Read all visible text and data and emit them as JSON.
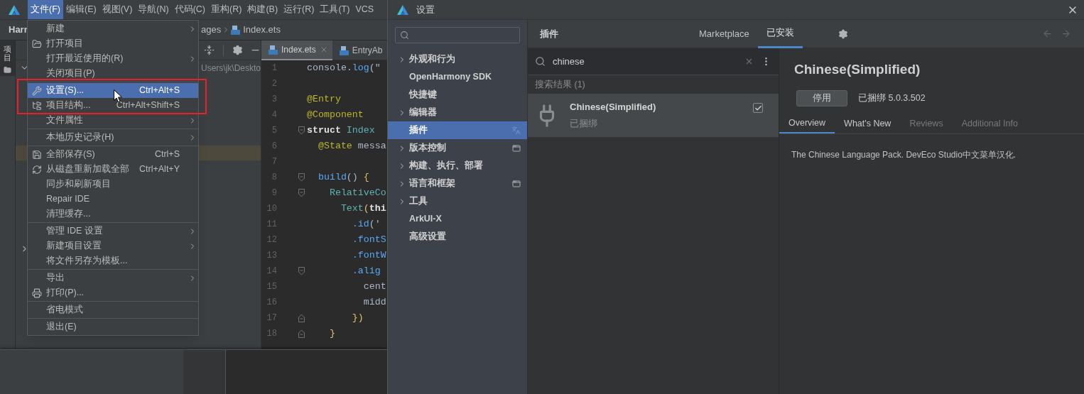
{
  "menubar": [
    {
      "label": "文件(F)",
      "selected": true
    },
    {
      "label": "编辑(E)",
      "selected": false
    },
    {
      "label": "视图(V)",
      "selected": false
    },
    {
      "label": "导航(N)",
      "selected": false
    },
    {
      "label": "代码(C)",
      "selected": false
    },
    {
      "label": "重构(R)",
      "selected": false
    },
    {
      "label": "构建(B)",
      "selected": false
    },
    {
      "label": "运行(R)",
      "selected": false
    },
    {
      "label": "工具(T)",
      "selected": false
    },
    {
      "label": "VCS",
      "selected": false
    }
  ],
  "breadcrumb": {
    "project": "Harr",
    "folder": "ages",
    "file": "Index.ets"
  },
  "side_tab": {
    "label": "项目",
    "selected": true
  },
  "project_tree": {
    "path": "Users\\jk\\Deskto"
  },
  "editor_tabs": [
    {
      "label": "Index.ets",
      "selected": true,
      "closable": true
    },
    {
      "label": "EntryAb",
      "selected": false,
      "closable": false
    }
  ],
  "code_lines": [
    {
      "number": "1",
      "kind": "plain",
      "tokens": [
        {
          "t": "console.",
          "kind": "plain"
        },
        {
          "t": "log",
          "kind": "method"
        },
        {
          "t": "(\"",
          "kind": "plain"
        }
      ]
    },
    {
      "number": "2",
      "kind": "plain"
    },
    {
      "number": "3",
      "kind": "plain",
      "tokens": [
        {
          "t": "@Entry",
          "kind": "annotation"
        }
      ]
    },
    {
      "number": "4",
      "kind": "plain",
      "tokens": [
        {
          "t": "@Component",
          "kind": "annotation"
        }
      ]
    },
    {
      "number": "5",
      "kind": "fold_start",
      "tokens": [
        {
          "t": "struct",
          "kind": "keyword"
        },
        {
          "t": " Index",
          "kind": "type"
        }
      ]
    },
    {
      "number": "6",
      "kind": "plain",
      "tokens": [
        {
          "t": "  @State",
          "kind": "annotation"
        },
        {
          "t": " messa",
          "kind": "plain"
        }
      ]
    },
    {
      "number": "7",
      "kind": "plain"
    },
    {
      "number": "8",
      "kind": "fold_start",
      "tokens": [
        {
          "t": "  build",
          "kind": "method"
        },
        {
          "t": "() ",
          "kind": "plain"
        },
        {
          "t": "{",
          "kind": "brace"
        }
      ]
    },
    {
      "number": "9",
      "kind": "fold_start",
      "tokens": [
        {
          "t": "    RelativeCo",
          "kind": "type"
        }
      ]
    },
    {
      "number": "10",
      "kind": "plain",
      "tokens": [
        {
          "t": "      Text",
          "kind": "type"
        },
        {
          "t": "(",
          "kind": "brace"
        },
        {
          "t": "thi",
          "kind": "keyword"
        }
      ]
    },
    {
      "number": "11",
      "kind": "plain",
      "tokens": [
        {
          "t": "        .id",
          "kind": "method"
        },
        {
          "t": "('",
          "kind": "plain"
        }
      ]
    },
    {
      "number": "12",
      "kind": "plain",
      "tokens": [
        {
          "t": "        .fontS",
          "kind": "method"
        }
      ]
    },
    {
      "number": "13",
      "kind": "plain",
      "tokens": [
        {
          "t": "        .fontW",
          "kind": "method"
        }
      ]
    },
    {
      "number": "14",
      "kind": "fold_start",
      "tokens": [
        {
          "t": "        .alig",
          "kind": "method"
        }
      ]
    },
    {
      "number": "15",
      "kind": "plain",
      "tokens": [
        {
          "t": "          cent",
          "kind": "plain"
        }
      ]
    },
    {
      "number": "16",
      "kind": "plain",
      "tokens": [
        {
          "t": "          midd",
          "kind": "plain"
        }
      ]
    },
    {
      "number": "17",
      "kind": "fold_end",
      "tokens": [
        {
          "t": "        })",
          "kind": "brace"
        }
      ]
    },
    {
      "number": "18",
      "kind": "fold_end",
      "tokens": [
        {
          "t": "    }",
          "kind": "brace"
        }
      ]
    }
  ],
  "file_menu": {
    "groups": [
      [
        {
          "label": "新建",
          "kind": "plain",
          "submenu": true,
          "selected": false
        },
        {
          "label": "打开项目",
          "kind": "folder",
          "submenu": false,
          "selected": false
        },
        {
          "label": "打开最近使用的(R)",
          "kind": "plain",
          "submenu": true,
          "selected": false
        },
        {
          "label": "关闭项目(P)",
          "kind": "plain",
          "submenu": false,
          "selected": false
        }
      ],
      [
        {
          "label": "设置(S)...",
          "kind": "wrench",
          "shortcut": "Ctrl+Alt+S",
          "submenu": false,
          "selected": true
        },
        {
          "label": "项目结构...",
          "kind": "structure",
          "shortcut": "Ctrl+Alt+Shift+S",
          "submenu": false,
          "selected": false
        },
        {
          "label": "文件属性",
          "kind": "plain",
          "submenu": true,
          "selected": false
        }
      ],
      [
        {
          "label": "本地历史记录(H)",
          "kind": "plain",
          "submenu": true,
          "selected": false
        }
      ],
      [
        {
          "label": "全部保存(S)",
          "kind": "save",
          "shortcut": "Ctrl+S",
          "submenu": false,
          "selected": false
        },
        {
          "label": "从磁盘重新加载全部",
          "kind": "reload",
          "shortcut": "Ctrl+Alt+Y",
          "submenu": false,
          "selected": false
        },
        {
          "label": "同步和刷新项目",
          "kind": "plain",
          "submenu": false,
          "selected": false
        },
        {
          "label": "Repair IDE",
          "kind": "plain",
          "submenu": false,
          "selected": false
        },
        {
          "label": "清理缓存...",
          "kind": "plain",
          "submenu": false,
          "selected": false
        }
      ],
      [
        {
          "label": "管理 IDE 设置",
          "kind": "plain",
          "submenu": true,
          "selected": false
        },
        {
          "label": "新建项目设置",
          "kind": "plain",
          "submenu": true,
          "selected": false
        },
        {
          "label": "将文件另存为模板...",
          "kind": "plain",
          "submenu": false,
          "selected": false
        }
      ],
      [
        {
          "label": "导出",
          "kind": "plain",
          "submenu": true,
          "selected": false
        },
        {
          "label": "打印(P)...",
          "kind": "print",
          "submenu": false,
          "selected": false
        }
      ],
      [
        {
          "label": "省电模式",
          "kind": "plain",
          "submenu": false,
          "selected": false
        }
      ],
      [
        {
          "label": "退出(E)",
          "kind": "plain",
          "submenu": false,
          "selected": false
        }
      ]
    ]
  },
  "settings": {
    "title": "设置",
    "nav": [
      {
        "label": "外观和行为",
        "expandable": true,
        "selected": false,
        "kind": "plain"
      },
      {
        "label": "OpenHarmony SDK",
        "expandable": false,
        "selected": false,
        "kind": "plain"
      },
      {
        "label": "快捷键",
        "expandable": false,
        "selected": false,
        "kind": "plain"
      },
      {
        "label": "编辑器",
        "expandable": true,
        "selected": false,
        "kind": "plain"
      },
      {
        "label": "插件",
        "expandable": false,
        "selected": true,
        "kind": "language"
      },
      {
        "label": "版本控制",
        "expandable": true,
        "selected": false,
        "kind": "project"
      },
      {
        "label": "构建、执行、部署",
        "expandable": true,
        "selected": false,
        "kind": "plain"
      },
      {
        "label": "语言和框架",
        "expandable": true,
        "selected": false,
        "kind": "project"
      },
      {
        "label": "工具",
        "expandable": true,
        "selected": false,
        "kind": "plain"
      },
      {
        "label": "ArkUI-X",
        "expandable": false,
        "selected": false,
        "kind": "plain"
      },
      {
        "label": "高级设置",
        "expandable": false,
        "selected": false,
        "kind": "plain"
      }
    ],
    "page_title": "插件",
    "tabs": [
      {
        "label": "Marketplace",
        "selected": false
      },
      {
        "label": "已安装",
        "selected": true
      }
    ],
    "plugin_search": {
      "value": "chinese"
    },
    "results_label": "搜索结果 (1)",
    "plugins": [
      {
        "name": "Chinese(Simplified)",
        "status": "已捆绑",
        "enabled": true,
        "selected": true
      }
    ],
    "detail": {
      "title": "Chinese(Simplified)",
      "button": "停用",
      "version": "已捆绑 5.0.3.502",
      "tabs": [
        {
          "label": "Overview",
          "selected": true,
          "disabled": false
        },
        {
          "label": "What's New",
          "selected": false,
          "disabled": false
        },
        {
          "label": "Reviews",
          "selected": false,
          "disabled": true
        },
        {
          "label": "Additional Info",
          "selected": false,
          "disabled": true
        }
      ],
      "description": "The Chinese Language Pack. DevEco Studio中文菜单汉化."
    }
  }
}
